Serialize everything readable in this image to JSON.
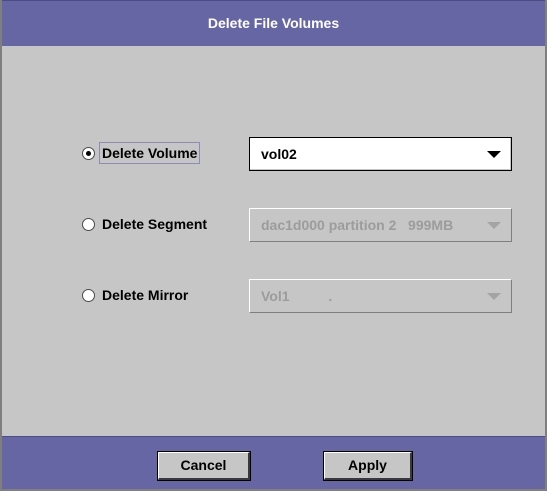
{
  "dialog": {
    "title": "Delete File Volumes"
  },
  "options": [
    {
      "label": "Delete Volume",
      "selected": true,
      "focused": true,
      "combo_value": "vol02",
      "combo_enabled": true
    },
    {
      "label": "Delete Segment",
      "selected": false,
      "focused": false,
      "combo_value": "dac1d000 partition 2   999MB",
      "combo_enabled": false
    },
    {
      "label": "Delete Mirror",
      "selected": false,
      "focused": false,
      "combo_value": "Vol1          .",
      "combo_enabled": false
    }
  ],
  "buttons": {
    "cancel_label": "Cancel",
    "apply_label": "Apply"
  },
  "colors": {
    "title_bar": "#6666a4",
    "panel_background": "#c6c6c6",
    "disabled_text": "#9c9c9c"
  }
}
